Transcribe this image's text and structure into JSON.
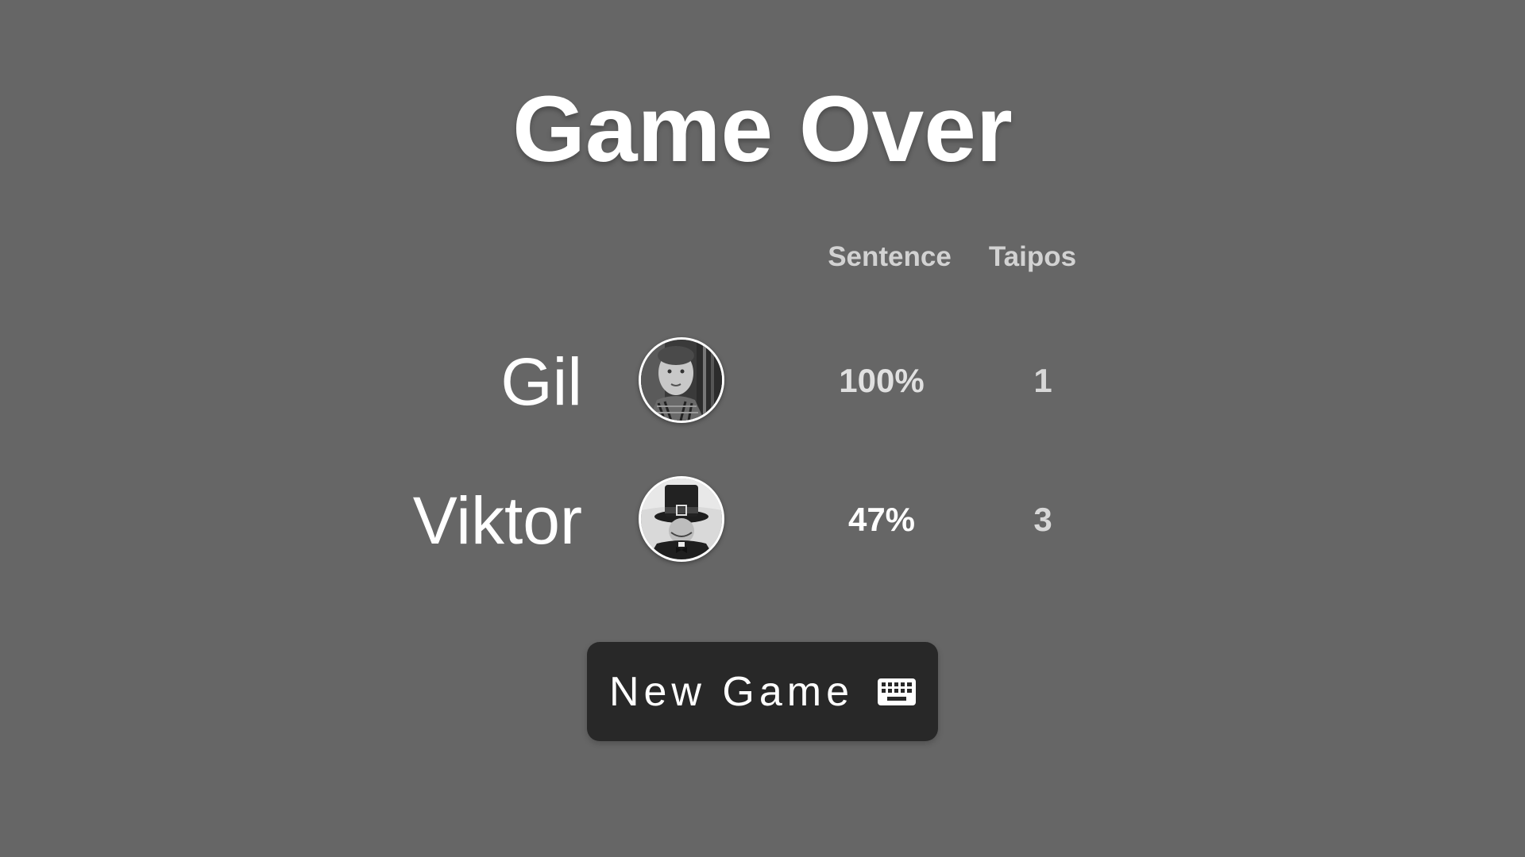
{
  "title": "Game Over",
  "columns": {
    "sentence": "Sentence",
    "taipos": "Taipos"
  },
  "players": [
    {
      "name": "Gil",
      "avatar": "gil-avatar",
      "sentence": "100%",
      "taipos": "1"
    },
    {
      "name": "Viktor",
      "avatar": "viktor-avatar",
      "sentence": "47%",
      "taipos": "3"
    }
  ],
  "new_game": {
    "label": "New Game",
    "icon": "keyboard-icon"
  },
  "colors": {
    "background": "#666666",
    "button": "#282828",
    "text": "#ffffff",
    "header": "#d2d2d2"
  }
}
